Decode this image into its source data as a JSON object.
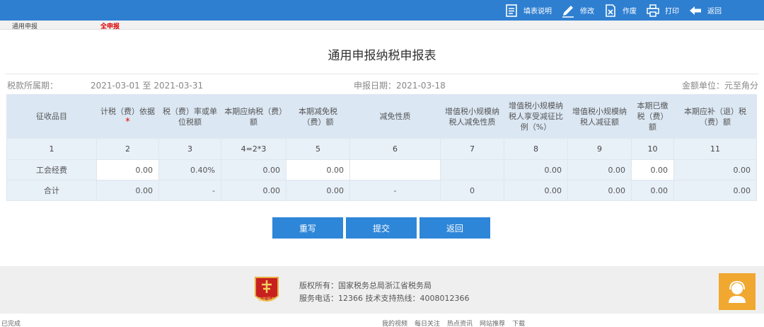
{
  "toolbar": {
    "fill_guide": "填表说明",
    "modify": "修改",
    "void": "作废",
    "print": "打印",
    "back": "返回"
  },
  "tabs": {
    "general": "通用申报",
    "full": "全申报"
  },
  "page_title": "通用申报纳税申报表",
  "info": {
    "period_label": "税款所属期：",
    "period_value": "2021-03-01 至 2021-03-31",
    "declare_date": "申报日期：2021-03-18",
    "amount_unit": "金额单位：元至角分"
  },
  "table": {
    "headers": [
      "征收品目",
      "计税（费）依据",
      "税（费）率或单位税额",
      "本期应纳税（费）额",
      "本期减免税（费）额",
      "减免性质",
      "增值税小规模纳税人减免性质",
      "增值税小规模纳税人享受减征比例（%）",
      "增值税小规模纳税人减征额",
      "本期已缴税（费）额",
      "本期应补（退）税（费）额"
    ],
    "required_mark": "*",
    "index_row": [
      "1",
      "2",
      "3",
      "4=2*3",
      "5",
      "6",
      "7",
      "8",
      "9",
      "10",
      "11"
    ],
    "rows": [
      [
        "工会经费",
        "0.00",
        "0.40%",
        "0.00",
        "0.00",
        "",
        "",
        "0.00",
        "0.00",
        "0.00",
        "0.00"
      ],
      [
        "合计",
        "0.00",
        "-",
        "0.00",
        "0.00",
        "-",
        "0",
        "0.00",
        "0.00",
        "0.00",
        "0.00"
      ]
    ]
  },
  "buttons": {
    "rewrite": "重写",
    "submit": "提交",
    "back": "返回"
  },
  "footer": {
    "copyright": "版权所有：国家税务总局浙江省税务局",
    "phone": "服务电话：12366 技术支持热线：4008012366",
    "logo_text": "智能服务"
  },
  "statusbar": {
    "left": "已完成",
    "right_items": [
      "我的视频",
      "每日关注",
      "热点资讯",
      "网站推荐",
      "下载"
    ]
  },
  "colors": {
    "toolbar_bg": "#2f7fd1",
    "header_bg": "#dbe7f3",
    "row_bg": "#e8f0f8",
    "button_bg": "#2e86d8",
    "required": "#e00000"
  }
}
